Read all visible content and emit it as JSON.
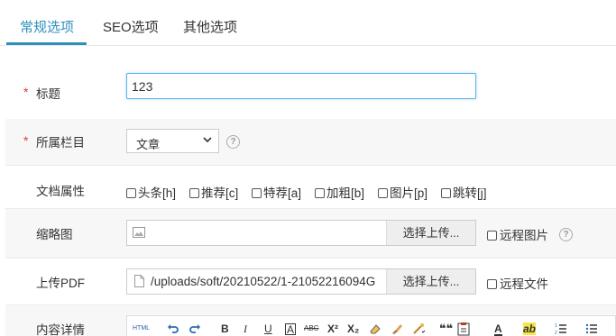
{
  "tabs": [
    {
      "label": "常规选项",
      "active": true
    },
    {
      "label": "SEO选项",
      "active": false
    },
    {
      "label": "其他选项",
      "active": false
    }
  ],
  "colors": {
    "accent": "#2d8fbf",
    "required": "#e4393c",
    "focus_border": "#5cb3e6"
  },
  "form": {
    "required_mark": "*",
    "title": {
      "label": "标题",
      "value": "123"
    },
    "column": {
      "label": "所属栏目",
      "selected": "文章",
      "help": "?"
    },
    "doc_attrs": {
      "label": "文档属性",
      "options": [
        "头条[h]",
        "推荐[c]",
        "特荐[a]",
        "加粗[b]",
        "图片[p]",
        "跳转[j]"
      ]
    },
    "thumbnail": {
      "label": "缩略图",
      "button": "选择上传...",
      "remote_label": "远程图片",
      "help": "?"
    },
    "pdf": {
      "label": "上传PDF",
      "value": "/uploads/soft/20210522/1-21052216094G",
      "button": "选择上传...",
      "remote_label": "远程文件"
    },
    "content": {
      "label": "内容详情"
    }
  },
  "editor_toolbar": {
    "html": "HTML",
    "bold": "B",
    "italic": "I",
    "underline": "U",
    "fontborder": "A",
    "strike": "ABC",
    "sup": "X²",
    "sub": "X₂",
    "quote": "❝❝",
    "fontcolor": "A",
    "bgcolor": "ab"
  }
}
